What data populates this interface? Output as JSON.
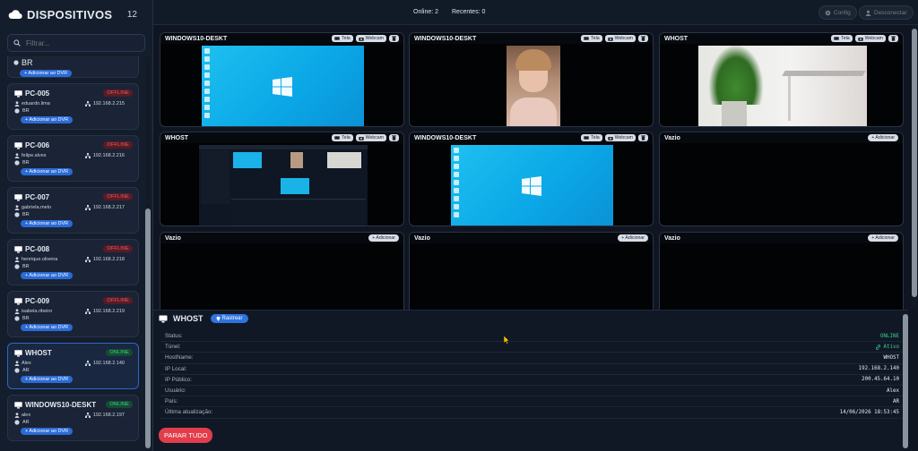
{
  "sidebar": {
    "title": "DISPOSITIVOS",
    "count": "12",
    "filter_placeholder": "Filtrar...",
    "partial_card": {
      "country": "BR",
      "dvr_label": "+ Adicionar ao DVR"
    },
    "devices": [
      {
        "name": "PC-005",
        "status": "OFFLINE",
        "user": "eduardo.lima",
        "ip": "192.168.2.215",
        "country": "BR",
        "dvr_label": "+ Adicionar ao DVR"
      },
      {
        "name": "PC-006",
        "status": "OFFLINE",
        "user": "felipe.alves",
        "ip": "192.168.2.216",
        "country": "BR",
        "dvr_label": "+ Adicionar ao DVR"
      },
      {
        "name": "PC-007",
        "status": "OFFLINE",
        "user": "gabriela.melo",
        "ip": "192.168.2.217",
        "country": "BR",
        "dvr_label": "+ Adicionar ao DVR"
      },
      {
        "name": "PC-008",
        "status": "OFFLINE",
        "user": "henrique.oliveira",
        "ip": "192.168.2.218",
        "country": "BR",
        "dvr_label": "+ Adicionar ao DVR"
      },
      {
        "name": "PC-009",
        "status": "OFFLINE",
        "user": "isabela.ribeiro",
        "ip": "192.168.2.219",
        "country": "BR",
        "dvr_label": "+ Adicionar ao DVR"
      },
      {
        "name": "WHOST",
        "status": "ONLINE",
        "user": "Alex",
        "ip": "192.168.2.140",
        "country": "AR",
        "dvr_label": "+ Adicionar ao DVR"
      },
      {
        "name": "WINDOWS10-DESKT",
        "status": "ONLINE",
        "user": "alex",
        "ip": "192.168.2.197",
        "country": "AR",
        "dvr_label": "+ Adicionar ao DVR"
      }
    ]
  },
  "topbar": {
    "online": "Online: 2",
    "recent": "Recentes: 0",
    "config": "Config",
    "user": "Desconectar"
  },
  "grid": {
    "btn_tela": "Tela",
    "btn_webcam": "Webcam",
    "btn_add": "+ Adicionar",
    "tiles": [
      {
        "title": "WINDOWS10-DESKT",
        "kind": "desktop"
      },
      {
        "title": "WINDOWS10-DESKT",
        "kind": "webcam-person"
      },
      {
        "title": "WHOST",
        "kind": "webcam-plant"
      },
      {
        "title": "WHOST",
        "kind": "screen-app"
      },
      {
        "title": "WINDOWS10-DESKT",
        "kind": "desktop"
      },
      {
        "title": "Vazio",
        "kind": "empty"
      },
      {
        "title": "Vazio",
        "kind": "empty"
      },
      {
        "title": "Vazio",
        "kind": "empty"
      },
      {
        "title": "Vazio",
        "kind": "empty"
      }
    ]
  },
  "details": {
    "title": "WHOST",
    "track_label": "Rastrear",
    "rows": [
      {
        "key": "Status:",
        "value": "ONLINE",
        "color": "#3dcf8e"
      },
      {
        "key": "Túnel:",
        "value": "Ativo",
        "color": "#3dcf8e"
      },
      {
        "key": "HostName:",
        "value": "WHOST"
      },
      {
        "key": "IP Local:",
        "value": "192.168.2.140"
      },
      {
        "key": "IP Público:",
        "value": "200.45.64.10"
      },
      {
        "key": "Usuário:",
        "value": "Alex"
      },
      {
        "key": "País:",
        "value": "AR"
      },
      {
        "key": "Última atualização:",
        "value": "14/06/2026 18:53:45"
      }
    ],
    "stop_all": "PARAR TUDO"
  }
}
